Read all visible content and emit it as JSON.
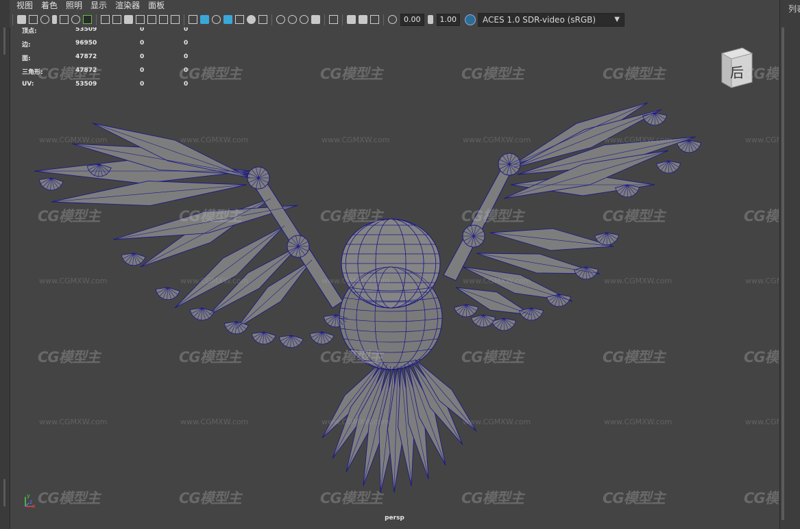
{
  "menu": [
    "视图",
    "着色",
    "照明",
    "显示",
    "渲染器",
    "面板"
  ],
  "toolbar": {
    "exposure": "0.00",
    "gamma": "1.00",
    "color_management": "ACES 1.0 SDR-video (sRGB)"
  },
  "hud": {
    "rows": [
      {
        "label": "顶点:",
        "a": "53509",
        "b": "0",
        "c": "0"
      },
      {
        "label": "边:",
        "a": "96950",
        "b": "0",
        "c": "0"
      },
      {
        "label": "面:",
        "a": "47872",
        "b": "0",
        "c": "0"
      },
      {
        "label": "三角形:",
        "a": "47872",
        "b": "0",
        "c": "0"
      },
      {
        "label": "UV:",
        "a": "53509",
        "b": "0",
        "c": "0"
      }
    ]
  },
  "viewport": {
    "camera_label": "persp"
  },
  "viewcube": {
    "label": "后"
  },
  "axis": {
    "x": "x",
    "y": "y",
    "z": "z"
  },
  "right_panel": {
    "label": "列表"
  },
  "watermark": {
    "logo": "CG模型主",
    "url": "www.CGMXW.com"
  },
  "colors": {
    "wire": "#1c1a85",
    "mesh": "#7d7d7d",
    "bg": "#444444",
    "accent": "#3ba7d8"
  }
}
